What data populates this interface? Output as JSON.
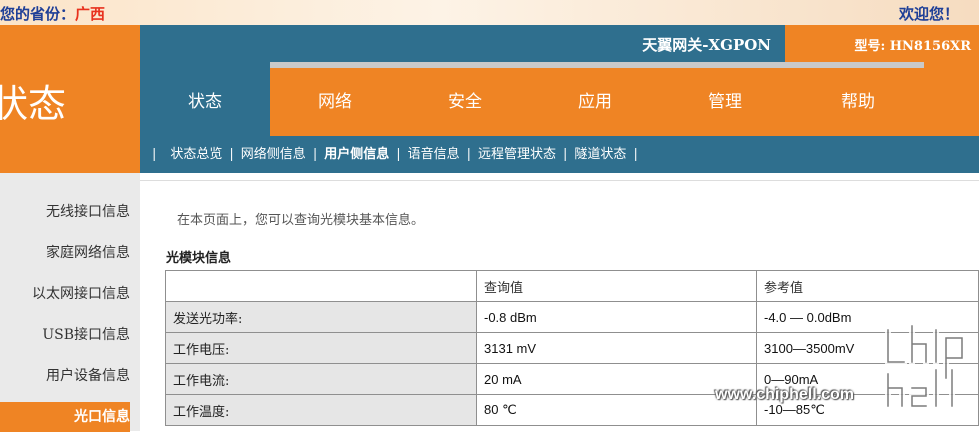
{
  "header": {
    "province_label": "您的省份：",
    "province_value": "广西",
    "welcome": "欢迎您！",
    "page_title": "状态",
    "gateway_name": "天翼网关-XGPON",
    "model": "型号: HN8156XR"
  },
  "tabs": [
    {
      "label": "状态"
    },
    {
      "label": "网络"
    },
    {
      "label": "安全"
    },
    {
      "label": "应用"
    },
    {
      "label": "管理"
    },
    {
      "label": "帮助"
    }
  ],
  "subnav": {
    "separator": "|",
    "items": [
      {
        "label": "状态总览"
      },
      {
        "label": "网络侧信息"
      },
      {
        "label": "用户侧信息"
      },
      {
        "label": "语音信息"
      },
      {
        "label": "远程管理状态"
      },
      {
        "label": "隧道状态"
      }
    ]
  },
  "sidebar": {
    "items": [
      {
        "label": "无线接口信息"
      },
      {
        "label": "家庭网络信息"
      },
      {
        "label": "以太网接口信息"
      },
      {
        "label": "USB接口信息"
      },
      {
        "label": "用户设备信息"
      },
      {
        "label": "光口信息"
      }
    ]
  },
  "content": {
    "intro": "在本页面上，您可以查询光模块基本信息。",
    "section_title": "光模块信息",
    "table": {
      "headers": [
        "",
        "查询值",
        "参考值"
      ],
      "rows": [
        {
          "name": "发送光功率:",
          "value": "-0.8 dBm",
          "ref": "-4.0 — 0.0dBm"
        },
        {
          "name": "工作电压:",
          "value": "3131 mV",
          "ref": "3100—3500mV"
        },
        {
          "name": "工作电流:",
          "value": "20 mA",
          "ref": "0—90mA"
        },
        {
          "name": "工作温度:",
          "value": "80 ℃",
          "ref": "-10—85℃"
        }
      ]
    }
  },
  "watermark": {
    "url": "www.chiphell.com"
  },
  "colors": {
    "orange": "#ef8424",
    "teal": "#2f6f8e",
    "province_red": "#e8321e",
    "header_blue": "#1f3f97"
  }
}
